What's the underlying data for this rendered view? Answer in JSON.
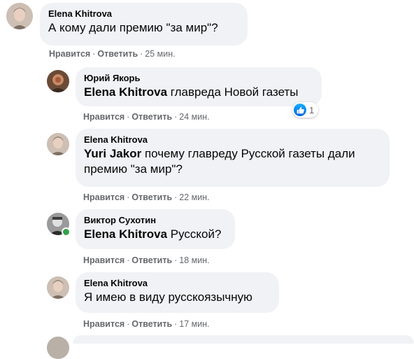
{
  "comments": [
    {
      "author": "Elena Khitrova",
      "mention": "",
      "text": "А кому дали премию \"за мир\"?",
      "like": "Нравится",
      "reply": "Ответить",
      "time": "25 мин."
    },
    {
      "author": "Юрий Якорь",
      "mention": "Elena Khitrova",
      "text": "главреда Новой газеты",
      "like": "Нравится",
      "reply": "Ответить",
      "time": "24 мин.",
      "reaction_count": "1",
      "reaction_icon": "like-thumb-icon"
    },
    {
      "author": "Elena Khitrova",
      "mention": "Yuri Jakor",
      "text_line1": "почему главреду Русской газеты дали",
      "text_line2": "премию \"за мир\"?",
      "like": "Нравится",
      "reply": "Ответить",
      "time": "22 мин."
    },
    {
      "author": "Виктор Сухотин",
      "mention": "Elena Khitrova",
      "text": "Русской?",
      "like": "Нравится",
      "reply": "Ответить",
      "time": "18 мин."
    },
    {
      "author": "Elena Khitrova",
      "mention": "",
      "text": "Я имею в виду русскоязычную",
      "like": "Нравится",
      "reply": "Ответить",
      "time": "17 мин."
    }
  ],
  "colors": {
    "bubble": "#f0f2f5",
    "meta": "#65676b",
    "online": "#31a24c",
    "like_blue": "#1877f2"
  }
}
